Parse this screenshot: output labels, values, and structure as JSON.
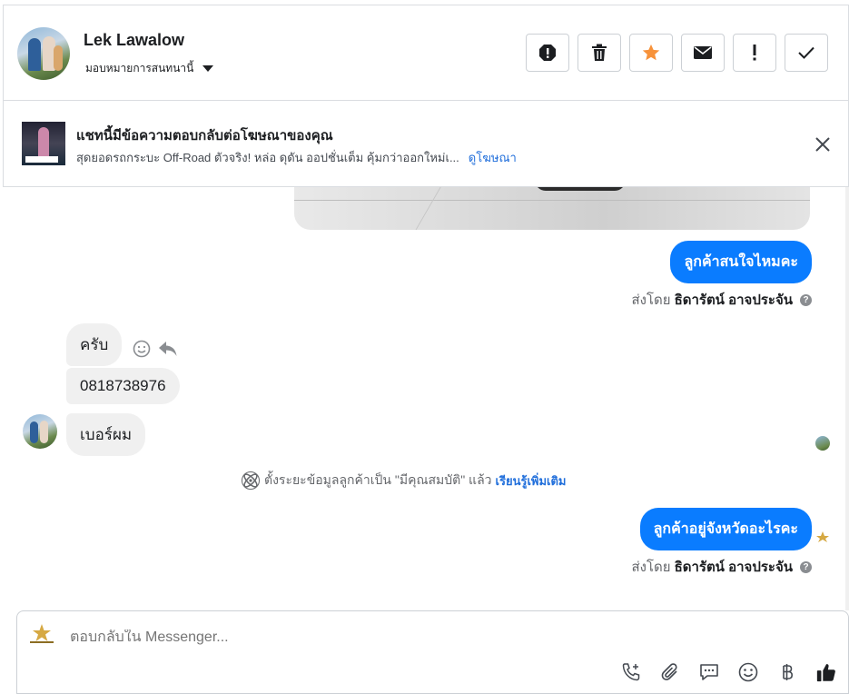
{
  "header": {
    "contact_name": "Lek Lawalow",
    "assign_label": "มอบหมายการสนทนานี้",
    "actions": [
      {
        "name": "spam",
        "icon": "alert-circle-icon"
      },
      {
        "name": "delete",
        "icon": "trash-icon"
      },
      {
        "name": "star",
        "icon": "star-icon",
        "color": "#f7923a"
      },
      {
        "name": "mark-unread",
        "icon": "envelope-icon"
      },
      {
        "name": "follow-up",
        "icon": "exclamation-icon"
      },
      {
        "name": "done",
        "icon": "check-icon"
      }
    ]
  },
  "ad_banner": {
    "title": "แชทนี้มีข้อความตอบกลับต่อโฆษณาของคุณ",
    "description": "สุดยอดรถกระบะ Off-Road ตัวจริง! หล่อ ดุดัน ออปชั่นเต็ม คุ้มกว่าออกใหม่เ...",
    "link": "ดูโฆษณา"
  },
  "messages": {
    "out1": {
      "text": "ลูกค้าสนใจไหมคะ",
      "sent_by_prefix": "ส่งโดย",
      "sender": "ธิดารัตน์ อาจประจัน"
    },
    "in1": "ครับ",
    "in2": "0818738976",
    "in3": "เบอร์ผม",
    "system_note": {
      "text": "ตั้งระยะข้อมูลลูกค้าเป็น \"มีคุณสมบัติ\" แล้ว",
      "link": "เรียนรู้เพิ่มเติม"
    },
    "out2": {
      "text": "ลูกค้าอยู่จังหวัดอะไรคะ",
      "sent_by_prefix": "ส่งโดย",
      "sender": "ธิดารัตน์ อาจประจัน"
    }
  },
  "composer": {
    "placeholder": "ตอบกลับใน Messenger...",
    "tools": [
      "phone-add-icon",
      "paperclip-icon",
      "chat-bubble-icon",
      "smiley-icon",
      "baht-icon",
      "thumbs-up-icon"
    ]
  },
  "colors": {
    "accent": "#0a7cff",
    "link": "#216fdb",
    "star": "#f7923a"
  }
}
